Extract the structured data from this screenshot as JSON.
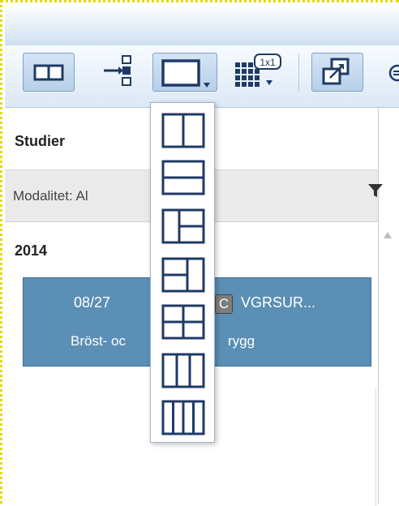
{
  "toolbar": {
    "buttons": [
      {
        "name": "side-by-side-view-button",
        "icon": "side-by-side-icon"
      },
      {
        "name": "hanging-protocol-button",
        "icon": "checklist-arrow-icon"
      },
      {
        "name": "viewport-layout-button",
        "icon": "single-viewport-icon"
      },
      {
        "name": "tile-layout-button",
        "icon": "tile-grid-icon",
        "badge": "1x1"
      },
      {
        "name": "external-window-button",
        "icon": "external-window-icon"
      }
    ]
  },
  "layout_menu": {
    "items": [
      "two-columns",
      "two-rows",
      "left-plus-two-right",
      "two-left-plus-right",
      "four-grid",
      "three-columns",
      "four-columns"
    ]
  },
  "panel": {
    "tab_label": "Studier",
    "filter_label": "Modalitet: Al",
    "year": "2014",
    "study": {
      "date": "08/27",
      "badge": "C",
      "code": "VGRSUR...",
      "description": "Bröst- oc"
    },
    "study_description_tail": "rygg"
  },
  "colors": {
    "accent": "#5b8fb5",
    "icon_navy": "#1f3a66",
    "toolbar_bg": "#dce8f5"
  }
}
